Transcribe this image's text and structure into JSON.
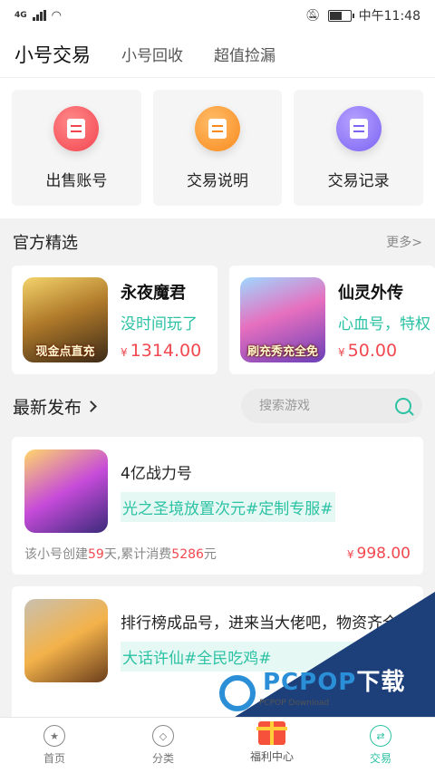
{
  "status_bar": {
    "network": "4G",
    "time": "中午11:48"
  },
  "top_nav": {
    "tabs": [
      "小号交易",
      "小号回收",
      "超值捡漏"
    ]
  },
  "actions": [
    {
      "label": "出售账号",
      "icon": "sell-account-icon"
    },
    {
      "label": "交易说明",
      "icon": "trade-guide-icon"
    },
    {
      "label": "交易记录",
      "icon": "trade-record-icon"
    }
  ],
  "featured": {
    "title": "官方精选",
    "more": "更多>",
    "items": [
      {
        "name": "永夜魔君",
        "desc": "没时间玩了",
        "currency": "¥",
        "price": "1314.00",
        "thumb_caption": "现金点直充"
      },
      {
        "name": "仙灵外传",
        "desc": "心血号，特权",
        "currency": "¥",
        "price": "50.00",
        "thumb_caption": "刷充秀充全免"
      }
    ]
  },
  "latest": {
    "title": "最新发布",
    "search_placeholder": "搜索游戏",
    "items": [
      {
        "title": "4亿战力号",
        "tag": "光之圣境放置次元#定制专服#",
        "stats_prefix": "该小号创建",
        "days": "59",
        "stats_mid": "天,累计消费",
        "spent": "5286",
        "stats_suffix": "元",
        "currency": "¥",
        "price": "998.00"
      },
      {
        "title": "排行榜成品号，进来当大佬吧，物资齐全",
        "tag": "大话许仙#全民吃鸡#",
        "stats_prefix": "",
        "days": "",
        "stats_mid": "",
        "spent": "",
        "stats_suffix": "",
        "currency": "",
        "price": ""
      }
    ]
  },
  "bottom_nav": [
    {
      "label": "首页",
      "icon": "home-icon"
    },
    {
      "label": "分类",
      "icon": "category-icon"
    },
    {
      "label": "福利中心",
      "icon": "gift-icon"
    },
    {
      "label": "交易",
      "icon": "trade-icon"
    }
  ],
  "watermark": {
    "brand": "PCPOP",
    "brand_suffix": "下载",
    "sub": "PCPOP Download"
  },
  "colors": {
    "accent": "#2cc2a4",
    "price": "#f2484f"
  }
}
